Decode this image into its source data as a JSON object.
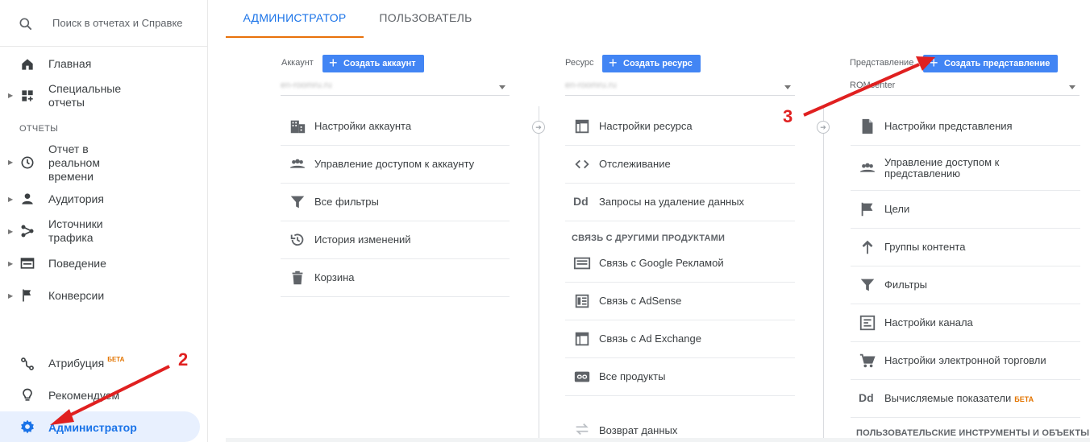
{
  "search": {
    "placeholder": "Поиск в отчетах и Справке"
  },
  "sidebar": {
    "section_reports": "ОТЧЕТЫ",
    "items": [
      {
        "label": "Главная",
        "icon": "home-icon"
      },
      {
        "label": "Специальные отчеты",
        "icon": "custom-reports-icon"
      },
      {
        "label": "Отчет в реальном времени",
        "icon": "clock-icon"
      },
      {
        "label": "Аудитория",
        "icon": "person-icon"
      },
      {
        "label": "Источники трафика",
        "icon": "acquisition-icon"
      },
      {
        "label": "Поведение",
        "icon": "behavior-icon"
      },
      {
        "label": "Конверсии",
        "icon": "flag-icon"
      },
      {
        "label": "Атрибуция",
        "icon": "attribution-icon",
        "badge": "БЕТА"
      },
      {
        "label": "Рекомендуем",
        "icon": "lightbulb-icon"
      },
      {
        "label": "Администратор",
        "icon": "gear-icon"
      }
    ]
  },
  "tabs": [
    {
      "label": "АДМИНИСТРАТОР",
      "active": true
    },
    {
      "label": "ПОЛЬЗОВАТЕЛЬ",
      "active": false
    }
  ],
  "account": {
    "heading": "Аккаунт",
    "create_label": "Создать аккаунт",
    "selected": "en-roomru.ru",
    "rows": [
      {
        "label": "Настройки аккаунта",
        "icon": "building-icon"
      },
      {
        "label": "Управление доступом к аккаунту",
        "icon": "people-icon"
      },
      {
        "label": "Все фильтры",
        "icon": "filter-icon"
      },
      {
        "label": "История изменений",
        "icon": "history-icon"
      },
      {
        "label": "Корзина",
        "icon": "trash-icon"
      }
    ]
  },
  "property": {
    "heading": "Ресурс",
    "create_label": "Создать ресурс",
    "selected": "en-roomru.ru",
    "rows": [
      {
        "label": "Настройки ресурса",
        "icon": "window-icon"
      },
      {
        "label": "Отслеживание",
        "icon": "code-icon"
      },
      {
        "label": "Запросы на удаление данных",
        "icon": "dd-icon",
        "icon_text": "Dd"
      }
    ],
    "linking_heading": "СВЯЗЬ С ДРУГИМИ ПРОДУКТАМИ",
    "linking_rows": [
      {
        "label": "Связь с Google Рекламой",
        "icon": "ads-link-icon"
      },
      {
        "label": "Связь с AdSense",
        "icon": "adsense-icon"
      },
      {
        "label": "Связь с Ad Exchange",
        "icon": "adx-icon"
      },
      {
        "label": "Все продукты",
        "icon": "link-icon"
      },
      {
        "label": "Возврат данных",
        "icon": "postback-icon"
      }
    ]
  },
  "view": {
    "heading": "Представление",
    "create_label": "Создать представление",
    "selected": "ROMcenter",
    "rows": [
      {
        "label": "Настройки представления",
        "icon": "document-icon"
      },
      {
        "label": "Управление доступом к представлению",
        "icon": "people-icon"
      },
      {
        "label": "Цели",
        "icon": "flag-icon"
      },
      {
        "label": "Группы контента",
        "icon": "content-groups-icon"
      },
      {
        "label": "Фильтры",
        "icon": "filter-icon"
      },
      {
        "label": "Настройки канала",
        "icon": "channel-settings-icon"
      },
      {
        "label": "Настройки электронной торговли",
        "icon": "cart-icon"
      },
      {
        "label": "Вычисляемые показатели",
        "icon": "dd-icon",
        "icon_text": "Dd",
        "badge": "БЕТА"
      }
    ],
    "tools_heading": "ПОЛЬЗОВАТЕЛЬСКИЕ ИНСТРУМЕНТЫ И ОБЪЕКТЫ"
  },
  "annotations": {
    "marker2": "2",
    "marker3": "3"
  },
  "colors": {
    "accent": "#1a73e8",
    "button": "#4285f4",
    "tab_underline": "#e8710a",
    "annotation": "#e02020",
    "beta": "#e37400"
  }
}
